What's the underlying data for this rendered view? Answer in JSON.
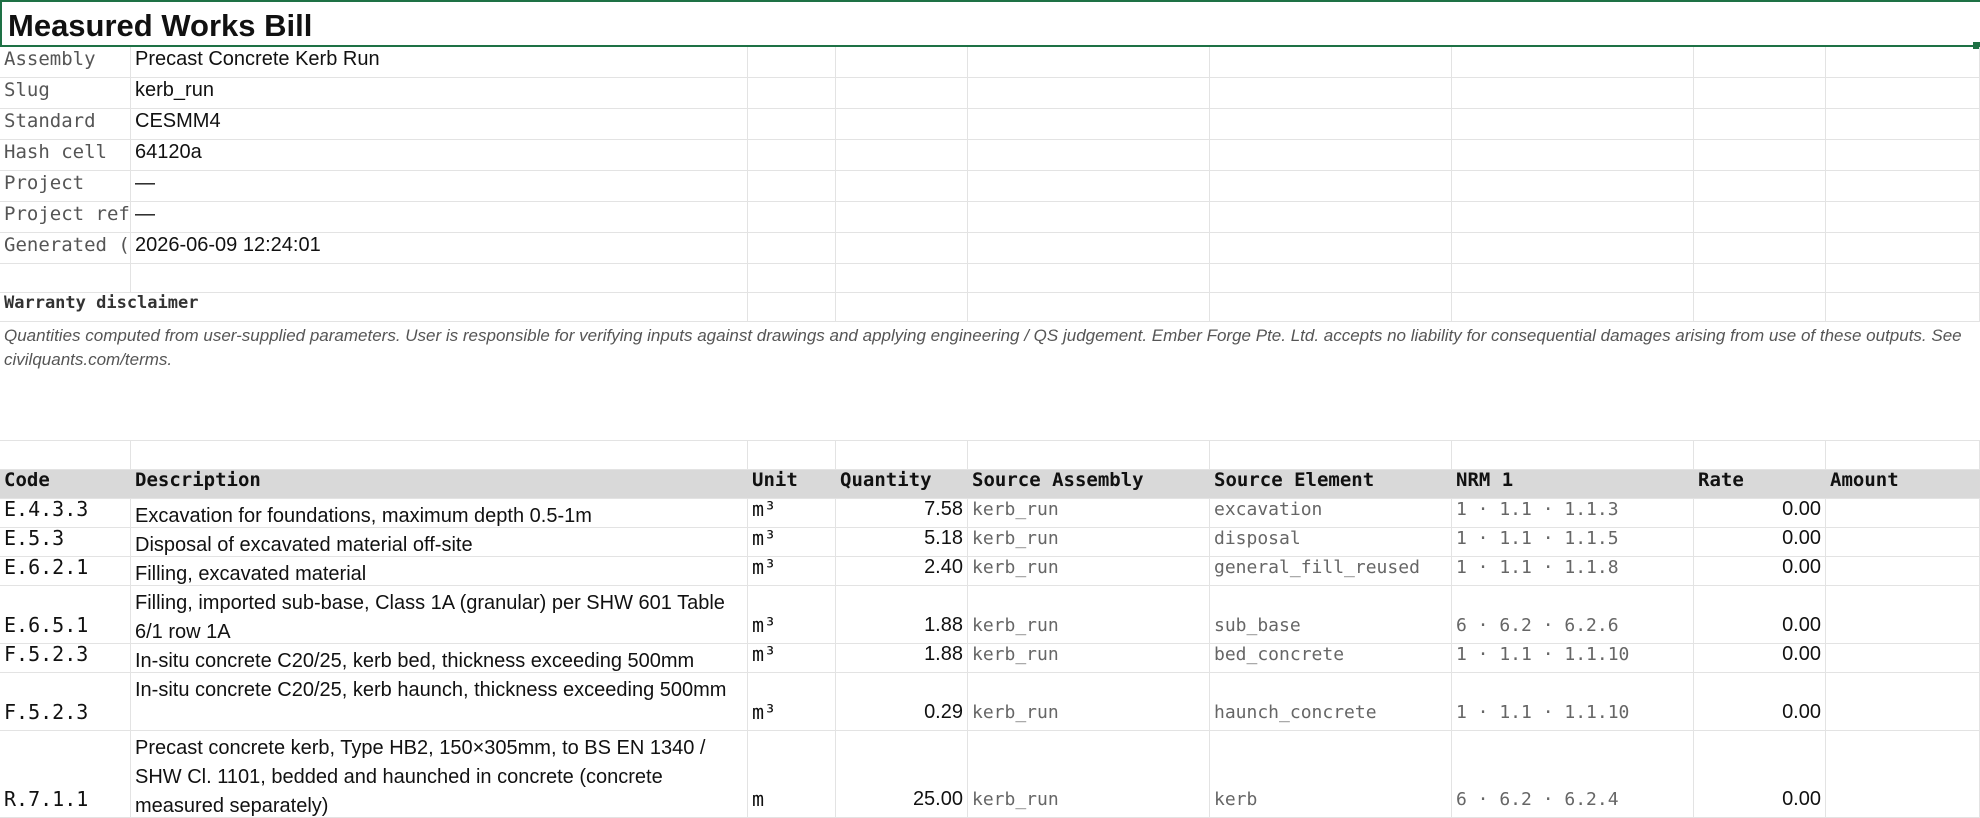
{
  "sheet": {
    "title": "Measured Works Bill"
  },
  "meta": [
    {
      "label": "Assembly",
      "value": "Precast Concrete Kerb Run"
    },
    {
      "label": "Slug",
      "value": "kerb_run"
    },
    {
      "label": "Standard",
      "value": "CESMM4"
    },
    {
      "label": "Hash cell",
      "value": "64120a"
    },
    {
      "label": "Project",
      "value": "—"
    },
    {
      "label": "Project ref",
      "value": "—"
    },
    {
      "label": "Generated (",
      "value": "2026-06-09 12:24:01"
    }
  ],
  "disclaimer": {
    "title": "Warranty disclaimer",
    "text": "Quantities computed from user-supplied parameters. User is responsible for verifying inputs against drawings and applying engineering / QS judgement. Ember Forge Pte. Ltd. accepts no liability for consequential damages arising from use of these outputs. See civilquants.com/terms."
  },
  "table": {
    "headers": [
      "Code",
      "Description",
      "Unit",
      "Quantity",
      "Source Assembly",
      "Source Element",
      "NRM 1",
      "Rate",
      "Amount"
    ],
    "rows": [
      {
        "code": "E.4.3.3",
        "description": "Excavation for foundations, maximum depth 0.5-1m",
        "unit": "m³",
        "quantity": "7.58",
        "source_assembly": "kerb_run",
        "source_element": "excavation",
        "nrm": "1 · 1.1 · 1.1.3",
        "rate": "0.00",
        "amount": ""
      },
      {
        "code": "E.5.3",
        "description": "Disposal of excavated material off-site",
        "unit": "m³",
        "quantity": "5.18",
        "source_assembly": "kerb_run",
        "source_element": "disposal",
        "nrm": "1 · 1.1 · 1.1.5",
        "rate": "0.00",
        "amount": ""
      },
      {
        "code": "E.6.2.1",
        "description": "Filling, excavated material",
        "unit": "m³",
        "quantity": "2.40",
        "source_assembly": "kerb_run",
        "source_element": "general_fill_reused",
        "nrm": "1 · 1.1 · 1.1.8",
        "rate": "0.00",
        "amount": ""
      },
      {
        "code": "E.6.5.1",
        "description": "Filling, imported sub-base, Class 1A (granular) per SHW 601 Table 6/1 row 1A",
        "unit": "m³",
        "quantity": "1.88",
        "source_assembly": "kerb_run",
        "source_element": "sub_base",
        "nrm": "6 · 6.2 · 6.2.6",
        "rate": "0.00",
        "amount": ""
      },
      {
        "code": "F.5.2.3",
        "description": "In-situ concrete C20/25, kerb bed, thickness exceeding 500mm",
        "unit": "m³",
        "quantity": "1.88",
        "source_assembly": "kerb_run",
        "source_element": "bed_concrete",
        "nrm": "1 · 1.1 · 1.1.10",
        "rate": "0.00",
        "amount": ""
      },
      {
        "code": "F.5.2.3",
        "description": "In-situ concrete C20/25, kerb haunch, thickness exceeding 500mm",
        "unit": "m³",
        "quantity": "0.29",
        "source_assembly": "kerb_run",
        "source_element": "haunch_concrete",
        "nrm": "1 · 1.1 · 1.1.10",
        "rate": "0.00",
        "amount": ""
      },
      {
        "code": "R.7.1.1",
        "description": "Precast concrete kerb, Type HB2, 150×305mm, to BS EN 1340 / SHW Cl. 1101, bedded and haunched in concrete (concrete measured separately)",
        "unit": "m",
        "quantity": "25.00",
        "source_assembly": "kerb_run",
        "source_element": "kerb",
        "nrm": "6 · 6.2 · 6.2.4",
        "rate": "0.00",
        "amount": ""
      }
    ]
  }
}
